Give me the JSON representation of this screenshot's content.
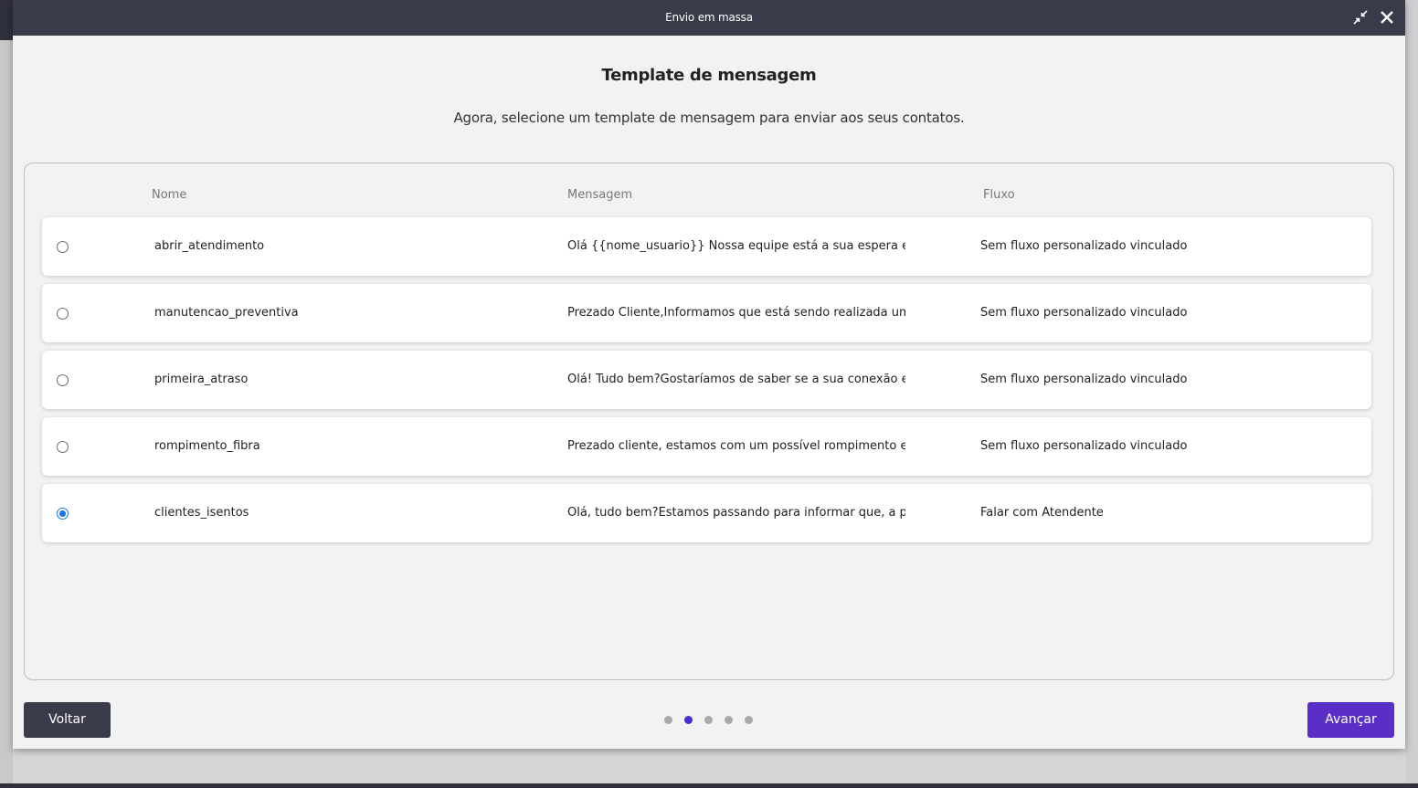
{
  "window": {
    "title": "Envio em massa",
    "minimize_icon": "minimize-arrows-icon",
    "close_icon": "close-icon"
  },
  "content": {
    "title": "Template de mensagem",
    "subtitle": "Agora, selecione um template de mensagem para enviar aos seus contatos."
  },
  "table": {
    "columns": [
      "Nome",
      "Mensagem",
      "Fluxo"
    ],
    "rows": [
      {
        "selected": false,
        "nome": "abrir_atendimento",
        "mensagem": "Olá {{nome_usuario}} Nossa equipe está a sua espera e est...",
        "fluxo": "Sem fluxo personalizado vinculado"
      },
      {
        "selected": false,
        "nome": "manutencao_preventiva",
        "mensagem": "Prezado Cliente,Informamos que está sendo realizada um...",
        "fluxo": "Sem fluxo personalizado vinculado"
      },
      {
        "selected": false,
        "nome": "primeira_atraso",
        "mensagem": "Olá! Tudo bem?Gostaríamos de saber se a sua conexão es...",
        "fluxo": "Sem fluxo personalizado vinculado"
      },
      {
        "selected": false,
        "nome": "rompimento_fibra",
        "mensagem": "Prezado cliente, estamos com um possível rompimento e...",
        "fluxo": "Sem fluxo personalizado vinculado"
      },
      {
        "selected": true,
        "nome": "clientes_isentos",
        "mensagem": "Olá, tudo bem?Estamos passando para informar que, a par...",
        "fluxo": "Falar com Atendente"
      }
    ]
  },
  "footer": {
    "back_label": "Voltar",
    "next_label": "Avançar",
    "steps_total": 5,
    "current_step": 2
  },
  "colors": {
    "header_bg": "#3a3b4a",
    "accent": "#5a2fc7",
    "radio_selected": "#1a73e8"
  }
}
